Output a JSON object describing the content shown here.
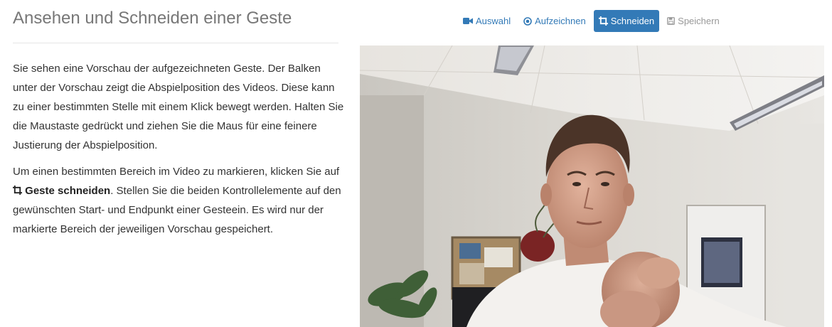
{
  "page": {
    "title": "Ansehen und Schneiden einer Geste"
  },
  "toolbar": {
    "buttons": [
      {
        "label": "Auswahl",
        "icon": "video-camera-icon",
        "state": "link"
      },
      {
        "label": "Aufzeichnen",
        "icon": "record-icon",
        "state": "link"
      },
      {
        "label": "Schneiden",
        "icon": "crop-icon",
        "state": "active"
      },
      {
        "label": "Speichern",
        "icon": "save-icon",
        "state": "disabled"
      }
    ]
  },
  "instructions": {
    "paragraph1": "Sie sehen eine Vorschau der aufgezeichneten Geste. Der Balken unter der Vorschau zeigt die Abspielposition des Videos. Diese kann zu einer bestimmten Stelle mit einem Klick bewegt werden. Halten Sie die Maustaste gedrückt und ziehen Sie die Maus für eine feinere Justierung der Abspielposition.",
    "paragraph2_before": "Um einen bestimmten Bereich im Video zu markieren, klicken Sie auf",
    "paragraph2_strong": "Geste schneiden",
    "paragraph2_after": ". Stellen Sie die beiden Kontrollelemente auf den gewünschten Start- und Endpunkt einer Gesteein. Es wird nur der markierte Bereich der jeweiligen Vorschau gespeichert."
  },
  "colors": {
    "primary": "#337ab7",
    "title": "#777777",
    "body_text": "#333333",
    "disabled": "#999999"
  }
}
